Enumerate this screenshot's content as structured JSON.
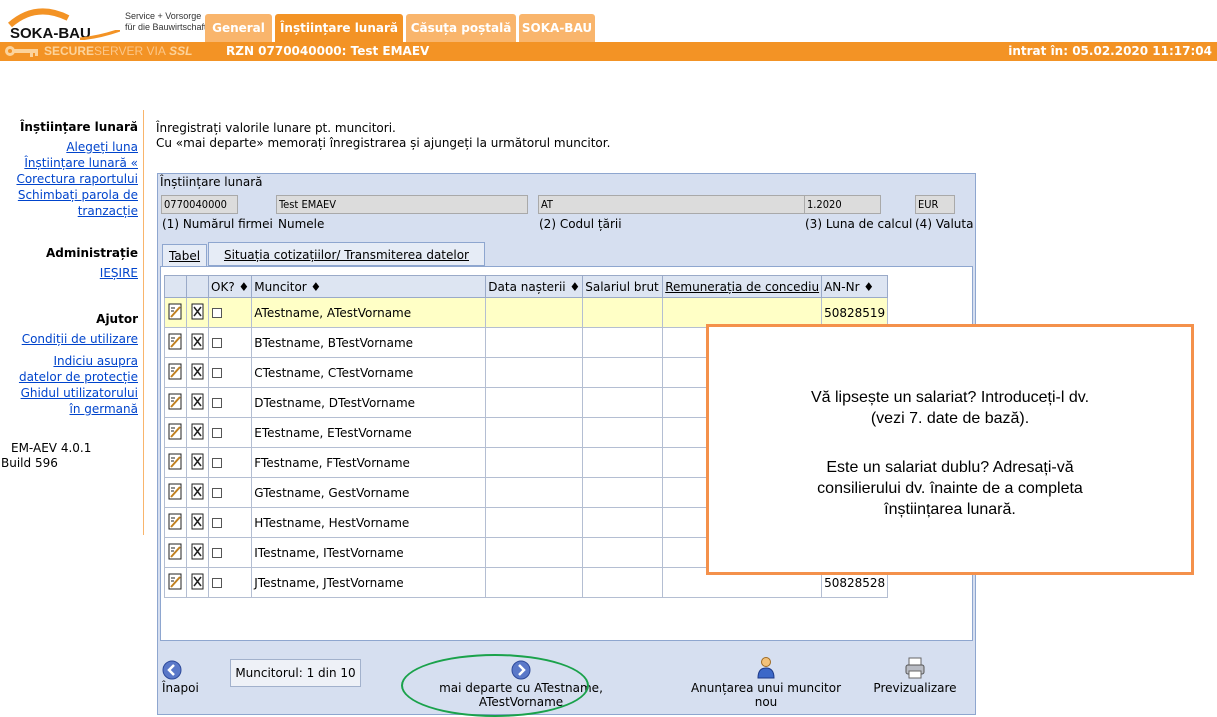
{
  "brand": {
    "logo_text": "SOKA-BAU",
    "tagline1": "Service + Vorsorge",
    "tagline2": "für die Bauwirtschaft"
  },
  "tabs": [
    {
      "label": "General",
      "active": false
    },
    {
      "label": "Înștiințare lunară",
      "active": true
    },
    {
      "label": "Căsuța poștală",
      "active": false
    },
    {
      "label": "SOKA-BAU",
      "active": false
    }
  ],
  "topbar": {
    "secure1": "SECURE",
    "secure2": "SERVER VIA",
    "secure3": "SSL",
    "rzn": "RZN 0770040000: Test EMAEV",
    "entered": "intrat în: 05.02.2020 11:17:04"
  },
  "sidebar": {
    "section1": "Înștiințare lunară",
    "choose_month": "Alegeți luna",
    "current_item": "Înștiințare lunară «",
    "report_correction": "Corectura raportului",
    "change_pw1": "Schimbați parola de",
    "change_pw2": "tranzacție",
    "section2": "Administrație",
    "exit": "IEȘIRE",
    "section3": "Ajutor",
    "terms": "Condiții de utilizare",
    "privacy1": "Indiciu asupra",
    "privacy2": "datelor de protecție",
    "guide1": "Ghidul utilizatorului",
    "guide2": "în germană",
    "version": "EM-AEV 4.0.1",
    "build": "Build 596"
  },
  "intro": {
    "line1": "Înregistrați valorile lunare pt. muncitori.",
    "line2": "Cu «mai departe» memorați înregistrarea și ajungeți la următorul muncitor."
  },
  "panel": {
    "title": "Înștiințare lunară",
    "firm_no": "0770040000",
    "name": "Test EMAEV",
    "country": "AT",
    "month": "1.2020",
    "currency": "EUR",
    "lbl_firm": "(1) Numărul firmei",
    "lbl_name": "Numele",
    "lbl_country": "(2) Codul țării",
    "lbl_month": "(3) Luna de calcul",
    "lbl_currency": "(4) Valuta",
    "tab_tabel": "Tabel",
    "tab_situatia": "Situația cotizațiilor/ Transmiterea datelor"
  },
  "table": {
    "headers": {
      "ok": "OK? ♦",
      "worker": "Muncitor ♦",
      "birth": "Data nașterii ♦",
      "salary": "Salariul brut",
      "vacation": "Remunerația de concediu",
      "an": "AN-Nr ♦"
    },
    "rows": [
      {
        "name": "ATestname, ATestVorname",
        "an": "50828519"
      },
      {
        "name": "BTestname, BTestVorname",
        "an": ""
      },
      {
        "name": "CTestname, CTestVorname",
        "an": ""
      },
      {
        "name": "DTestname, DTestVorname",
        "an": ""
      },
      {
        "name": "ETestname, ETestVorname",
        "an": ""
      },
      {
        "name": "FTestname, FTestVorname",
        "an": ""
      },
      {
        "name": "GTestname, GestVorname",
        "an": ""
      },
      {
        "name": "HTestname, HestVorname",
        "an": ""
      },
      {
        "name": "ITestname, ITestVorname",
        "an": ""
      },
      {
        "name": "JTestname, JTestVorname",
        "an": "50828528"
      }
    ]
  },
  "footer": {
    "back": "Înapoi",
    "counter": "Muncitorul: 1 din 10",
    "next": "mai departe cu ATestname, ATestVorname",
    "new_worker": "Anunțarea unui muncitor nou",
    "preview": "Previzualizare"
  },
  "callout": {
    "line1": "Vă lipsește un salariat? Introduceți-l dv.",
    "line2": "(vezi 7. date de bază).",
    "line3": "Este un salariat dublu? Adresați-vă",
    "line4": "consilierului dv. înainte de a completa",
    "line5": "înștiințarea lunară."
  },
  "colors": {
    "accent": "#f39325",
    "tab_inactive": "#f9b56c",
    "panel": "#d6dff0",
    "highlight": "#ffffc6",
    "callout_border": "#f4914b",
    "ring": "#1aa24b"
  }
}
